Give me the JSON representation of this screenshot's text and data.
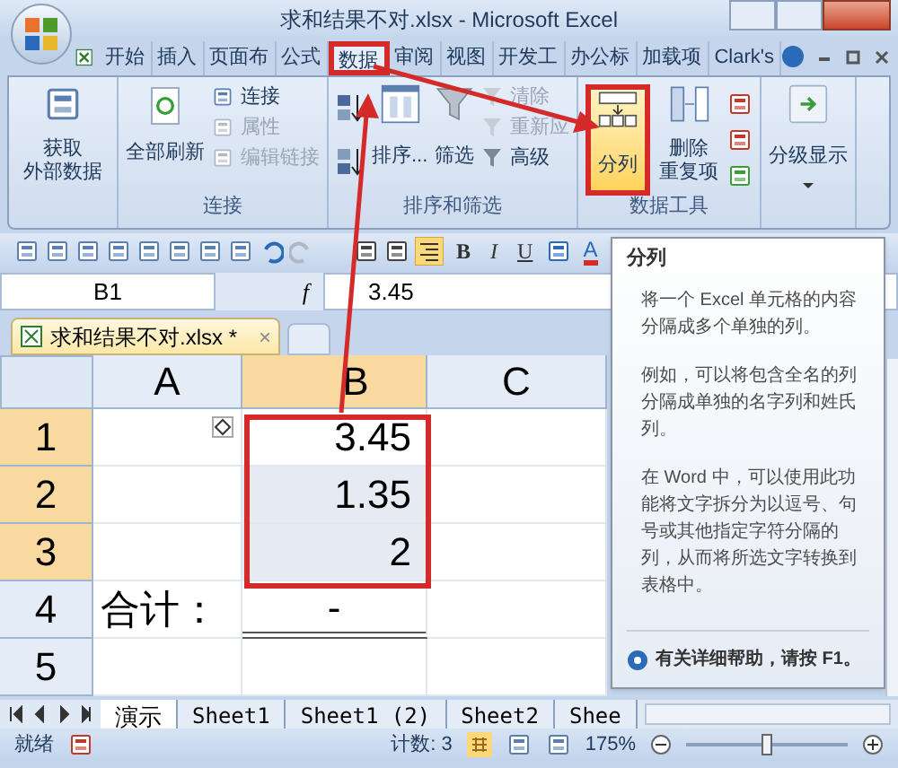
{
  "window": {
    "title": "求和结果不对.xlsx - Microsoft Excel"
  },
  "tabs": [
    {
      "label": "开始",
      "selected": false
    },
    {
      "label": "插入",
      "selected": false
    },
    {
      "label": "页面布",
      "selected": false
    },
    {
      "label": "公式",
      "selected": false
    },
    {
      "label": "数据",
      "selected": true
    },
    {
      "label": "审阅",
      "selected": false
    },
    {
      "label": "视图",
      "selected": false
    },
    {
      "label": "开发工",
      "selected": false
    },
    {
      "label": "办公标",
      "selected": false
    },
    {
      "label": "加载项",
      "selected": false
    },
    {
      "label": "Clark's",
      "selected": false
    }
  ],
  "ribbon": {
    "groups": [
      {
        "kind": "external",
        "buttons": [
          {
            "label_lines": [
              "获取",
              "外部数据"
            ],
            "disabled": false
          }
        ]
      },
      {
        "label": "连接",
        "kind": "connections",
        "buttons": [
          {
            "label": "全部刷新",
            "disabled": false
          },
          {
            "label": "连接",
            "disabled": false
          },
          {
            "label": "属性",
            "disabled": true
          },
          {
            "label": "编辑链接",
            "disabled": true
          }
        ]
      },
      {
        "label": "排序和筛选",
        "kind": "sort",
        "buttons": [
          {
            "label": "排序...",
            "disabled": false
          },
          {
            "label": "筛选",
            "disabled": false
          },
          {
            "label": "清除",
            "disabled": true
          },
          {
            "label": "重新应",
            "disabled": true
          },
          {
            "label": "高级",
            "disabled": false
          }
        ]
      },
      {
        "label": "数据工具",
        "kind": "tools",
        "buttons": [
          {
            "label": "分列",
            "selected": true
          },
          {
            "label_lines": [
              "删除",
              "重复项"
            ],
            "selected": false
          }
        ]
      },
      {
        "kind": "outline",
        "buttons": [
          {
            "label": "分级显示",
            "disabled": false
          }
        ]
      }
    ]
  },
  "toolbar": {
    "bold": "B",
    "italic": "I",
    "underline": "U",
    "font_color": "A"
  },
  "formula_bar": {
    "name_box": "B1",
    "fx": "f",
    "value": "3.45"
  },
  "document_tab": {
    "title": "求和结果不对.xlsx *",
    "close": "×"
  },
  "sheet": {
    "columns": [
      {
        "label": "A",
        "selected": false
      },
      {
        "label": "B",
        "selected": true
      },
      {
        "label": "C",
        "selected": false
      }
    ],
    "rows": [
      {
        "label": "1",
        "selected": true,
        "cells": [
          {
            "highlighted": false,
            "kind": "smart-tag"
          },
          {
            "value": "3.45",
            "highlighted": false
          },
          {
            "highlighted": false
          }
        ]
      },
      {
        "label": "2",
        "selected": true,
        "cells": [
          {
            "highlighted": false
          },
          {
            "value": "1.35",
            "highlighted": true
          },
          {
            "highlighted": false
          }
        ]
      },
      {
        "label": "3",
        "selected": true,
        "cells": [
          {
            "highlighted": false
          },
          {
            "value": "2",
            "highlighted": true
          },
          {
            "highlighted": false
          }
        ]
      },
      {
        "label": "4",
        "selected": false,
        "cells": [
          {
            "value": "合计：",
            "highlighted": false
          },
          {
            "value": "-",
            "highlighted": false,
            "kind": "double-underline"
          },
          {
            "highlighted": false
          }
        ]
      },
      {
        "label": "5",
        "selected": false,
        "cells": [
          {
            "highlighted": false
          },
          {
            "highlighted": false
          },
          {
            "highlighted": false
          }
        ]
      }
    ]
  },
  "tooltip": {
    "title": "分列",
    "paragraphs": [
      "将一个 Excel 单元格的内容分隔成多个单独的列。",
      "例如，可以将包含全名的列分隔成单独的名字列和姓氏列。",
      "在 Word 中，可以使用此功能将文字拆分为以逗号、句号或其他指定字符分隔的列，从而将所选文字转换到表格中。"
    ],
    "help": "有关详细帮助，请按 F1。"
  },
  "sheet_tabs": [
    {
      "label": "演示",
      "selected": true
    },
    {
      "label": "Sheet1",
      "selected": false
    },
    {
      "label": "Sheet1 (2)",
      "selected": false
    },
    {
      "label": "Sheet2",
      "selected": false
    },
    {
      "label": "Shee",
      "selected": false
    }
  ],
  "status_bar": {
    "ready": "就绪",
    "count": "计数: 3",
    "zoom": "175%",
    "zoom_level": {
      "level": 0.5
    }
  }
}
